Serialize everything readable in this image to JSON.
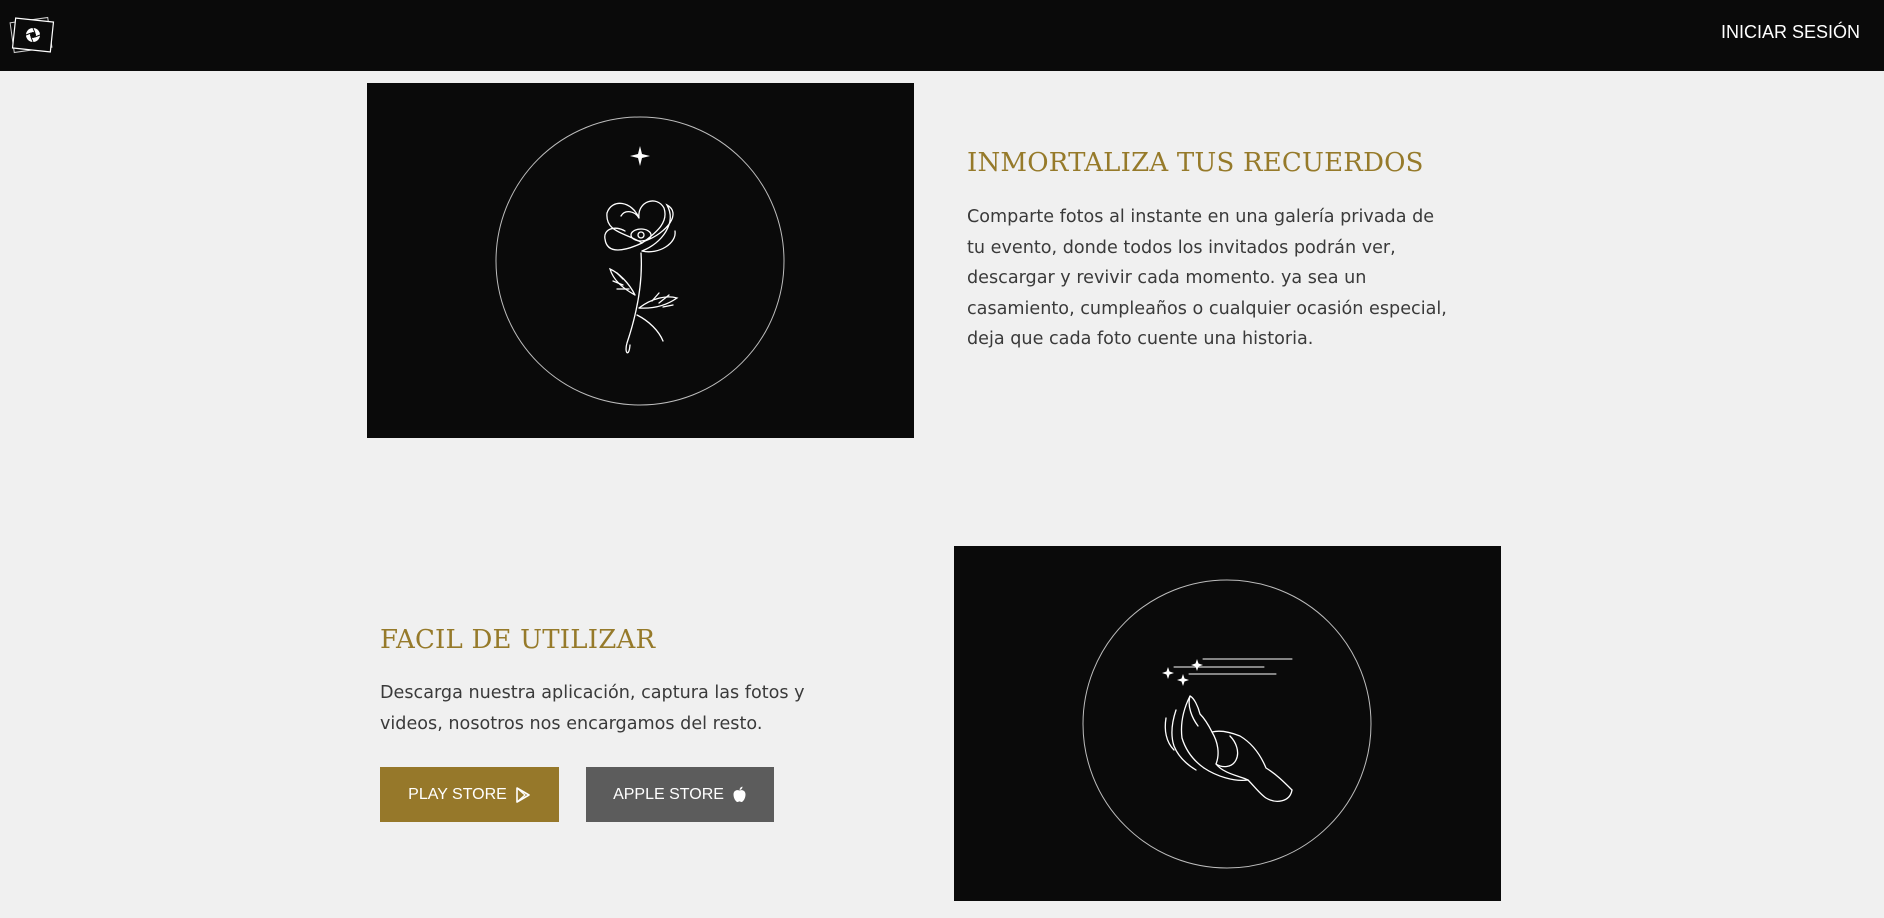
{
  "navbar": {
    "logo_icon": "camera-shutter-photos-icon",
    "login_label": "INICIAR SESIÓN"
  },
  "section_memories": {
    "title": "INMORTALIZA TUS RECUERDOS",
    "description": "Comparte fotos al instante en una galería privada de tu evento, donde todos los invitados podrán ver, descargar y revivir cada momento. ya sea un casamiento, cumpleaños o cualquier ocasión especial, deja que cada foto cuente una historia.",
    "illustration_icon": "flower-in-circle-icon"
  },
  "section_easy": {
    "title": "FACIL DE UTILIZAR",
    "description": "Descarga nuestra aplicación, captura las fotos y videos, nosotros nos encargamos del resto.",
    "play_store_label": "PLAY STORE",
    "play_store_icon": "google-play-icon",
    "apple_store_label": "APPLE STORE",
    "apple_store_icon": "apple-icon",
    "illustration_icon": "hand-with-sparkles-icon"
  },
  "colors": {
    "navbar_bg": "#0a0a0a",
    "page_bg": "#f0f0f0",
    "accent_gold": "#967a2a",
    "apple_button": "#5c5c5c",
    "body_text": "#3a3a3a"
  }
}
